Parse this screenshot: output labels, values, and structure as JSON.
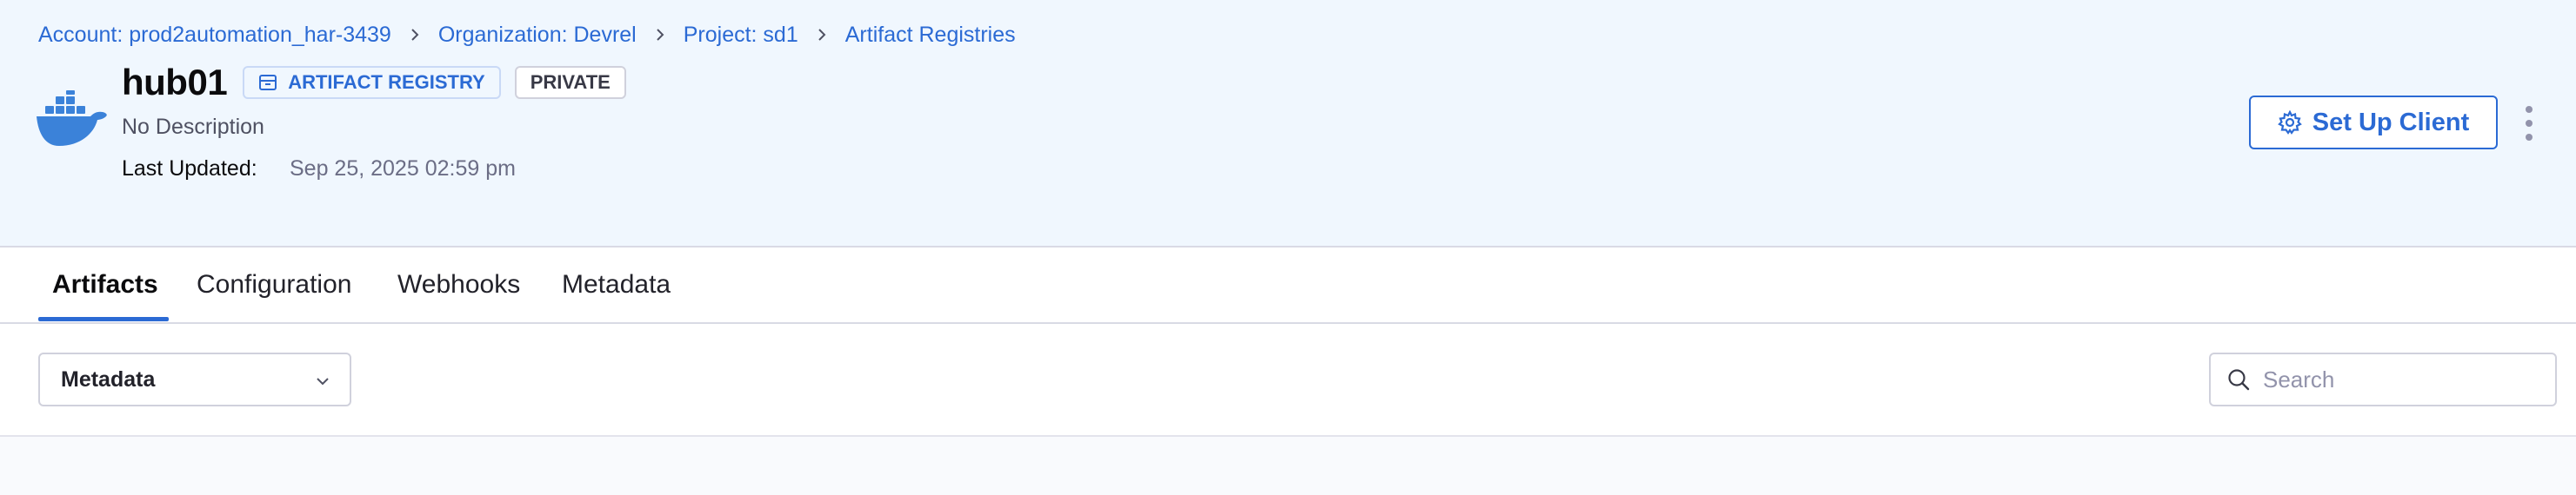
{
  "breadcrumb": [
    "Account: prod2automation_har-3439",
    "Organization: Devrel",
    "Project: sd1",
    "Artifact Registries"
  ],
  "registry": {
    "name": "hub01",
    "type_badge": "ARTIFACT REGISTRY",
    "visibility_badge": "PRIVATE",
    "description": "No Description",
    "last_updated_label": "Last Updated:",
    "last_updated_value": "Sep 25, 2025 02:59 pm",
    "logo_icon": "docker-whale-icon"
  },
  "actions": {
    "setup_client_label": "Set Up Client",
    "setup_client_icon": "gear-icon",
    "more_icon": "more-vertical-icon"
  },
  "tabs": [
    {
      "label": "Artifacts",
      "active": true
    },
    {
      "label": "Configuration",
      "active": false
    },
    {
      "label": "Webhooks",
      "active": false
    },
    {
      "label": "Metadata",
      "active": false
    }
  ],
  "toolbar": {
    "filter_selected": "Metadata",
    "search_placeholder": "Search"
  },
  "colors": {
    "accent": "#2b6ad4",
    "header_bg": "#f0f7fe",
    "docker_blue": "#3b82d9"
  }
}
